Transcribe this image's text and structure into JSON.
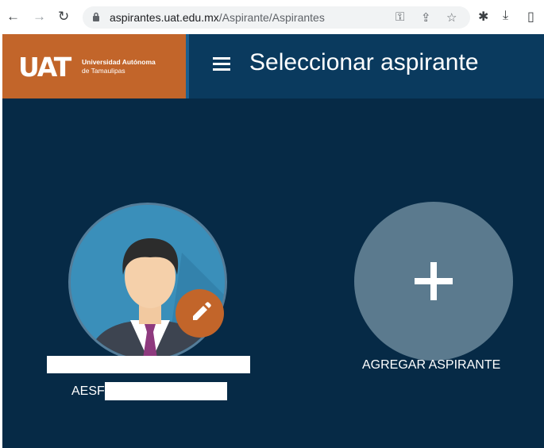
{
  "browser": {
    "url_host": "aspirantes.uat.edu.mx",
    "url_path": "/Aspirante/Aspirantes",
    "icons": [
      "back-icon",
      "forward-icon",
      "reload-icon",
      "lock-icon",
      "key-icon",
      "share-icon",
      "star-icon",
      "extensions-icon",
      "download-icon",
      "sidebar-icon"
    ]
  },
  "header": {
    "logo_text": "UAT",
    "university_line1": "Universidad Autónoma",
    "university_line2": "de Tamaulipas",
    "title": "Seleccionar aspirante"
  },
  "applicant": {
    "code_prefix": "AESF"
  },
  "add": {
    "label": "AGREGAR ASPIRANTE"
  },
  "colors": {
    "background": "#062a46",
    "header": "#0a3a5e",
    "brand": "#c2652a",
    "add_circle": "#5b7a8e"
  }
}
